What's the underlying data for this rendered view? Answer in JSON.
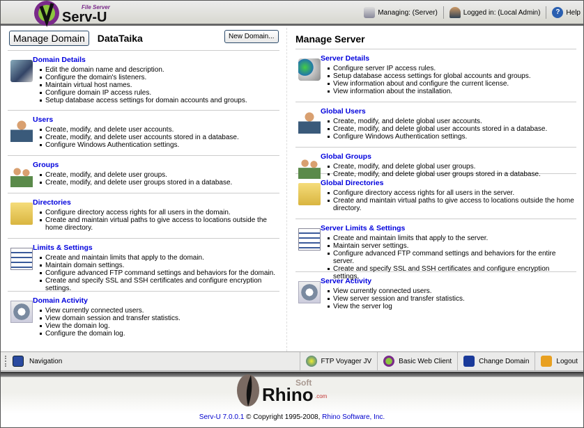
{
  "header": {
    "logo_text": "Serv-U",
    "logo_subtext": "File Server",
    "managing": "Managing: (Server)",
    "logged_in": "Logged in: (Local Admin)",
    "help": "Help"
  },
  "domain": {
    "manage_button": "Manage Domain",
    "domain_name": "DataTaika",
    "new_domain_button": "New Domain...",
    "sections": [
      {
        "title": "Domain Details",
        "icon": "computer-network-icon",
        "items": [
          "Edit the domain name and description.",
          "Configure the domain's listeners.",
          "Maintain virtual host names.",
          "Configure domain IP access rules.",
          "Setup database access settings for domain accounts and groups."
        ]
      },
      {
        "title": "Users",
        "icon": "user-icon",
        "items": [
          "Create, modify, and delete user accounts.",
          "Create, modify, and delete user accounts stored in a database.",
          "Configure Windows Authentication settings."
        ]
      },
      {
        "title": "Groups",
        "icon": "group-icon",
        "items": [
          "Create, modify, and delete user groups.",
          "Create, modify, and delete user groups stored in a database."
        ]
      },
      {
        "title": "Directories",
        "icon": "folder-icon",
        "items": [
          "Configure directory access rights for all users in the domain.",
          "Create and maintain virtual paths to give access to locations outside the home directory."
        ]
      },
      {
        "title": "Limits & Settings",
        "icon": "checklist-icon",
        "items": [
          "Create and maintain limits that apply to the domain.",
          "Maintain domain settings.",
          "Configure advanced FTP command settings and behaviors for the domain.",
          "Create and specify SSL and SSH certificates and configure encryption settings."
        ]
      },
      {
        "title": "Domain Activity",
        "icon": "activity-gear-icon",
        "items": [
          "View currently connected users.",
          "View domain session and transfer statistics.",
          "View the domain log.",
          "Configure the domain log."
        ]
      }
    ]
  },
  "server": {
    "title": "Manage Server",
    "sections": [
      {
        "title": "Server Details",
        "icon": "server-globe-icon",
        "items": [
          "Configure server IP access rules.",
          "Setup database access settings for global accounts and groups.",
          "View information about and configure the current license.",
          "View information about the installation."
        ]
      },
      {
        "title": "Global Users",
        "icon": "user-icon",
        "items": [
          "Create, modify, and delete global user accounts.",
          "Create, modify, and delete global user accounts stored in a database.",
          "Configure Windows Authentication settings."
        ]
      },
      {
        "title": "Global Groups",
        "icon": "group-icon",
        "items": [
          "Create, modify, and delete global user groups.",
          "Create, modify, and delete global user groups stored in a database."
        ]
      },
      {
        "title": "Global Directories",
        "icon": "folder-icon",
        "items": [
          "Configure directory access rights for all users in the server.",
          "Create and maintain virtual paths to give access to locations outside the home directory."
        ]
      },
      {
        "title": "Server Limits & Settings",
        "icon": "checklist-icon",
        "items": [
          "Create and maintain limits that apply to the server.",
          "Maintain server settings.",
          "Configure advanced FTP command settings and behaviors for the entire server.",
          "Create and specify SSL and SSH certificates and configure encryption settings."
        ]
      },
      {
        "title": "Server Activity",
        "icon": "activity-gear-icon",
        "items": [
          "View currently connected users.",
          "View server session and transfer statistics.",
          "View the server log"
        ]
      }
    ]
  },
  "toolbar": {
    "navigation": "Navigation",
    "ftp_voyager": "FTP Voyager JV",
    "basic_web_client": "Basic Web Client",
    "change_domain": "Change Domain",
    "logout": "Logout"
  },
  "footer": {
    "logo_text": "Rhino",
    "logo_soft": "Soft",
    "logo_com": ".com",
    "version": "Serv-U 7.0.0.1",
    "copyright": " © Copyright 1995-2008, ",
    "company": "Rhino Software, Inc."
  },
  "colors": {
    "link": "#0000dd",
    "accent_purple": "#7a2a8a",
    "accent_green": "#8cc63f"
  }
}
